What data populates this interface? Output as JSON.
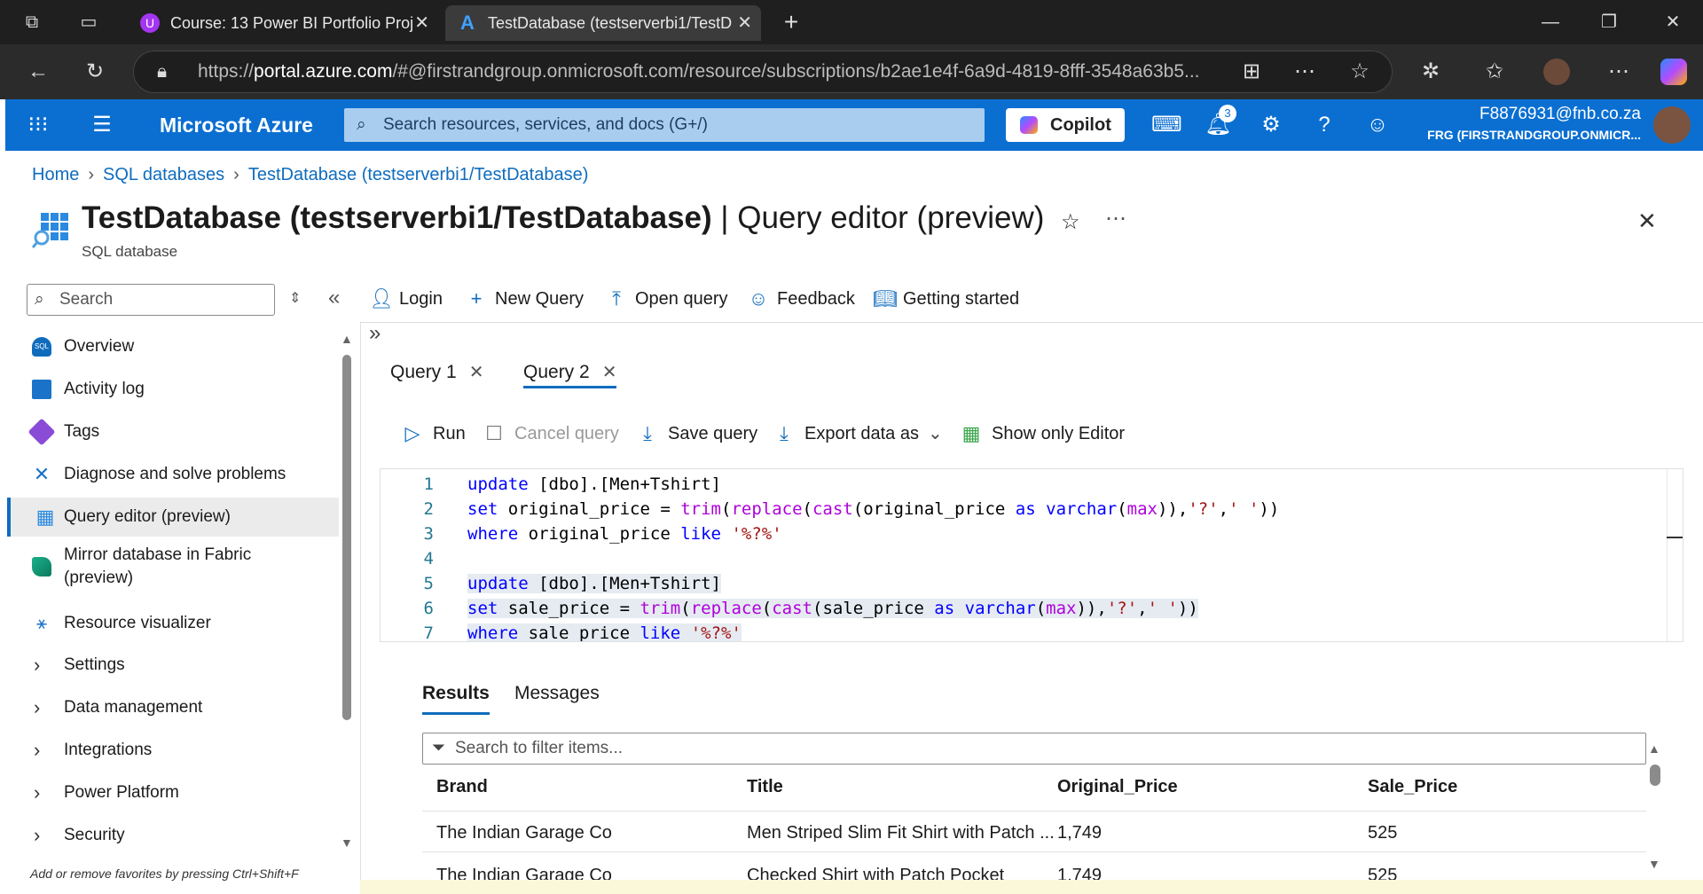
{
  "browser": {
    "tabs": [
      {
        "title": "Course: 13 Power BI Portfolio Proj"
      },
      {
        "title": "TestDatabase (testserverbi1/TestD"
      }
    ],
    "url_prefix": "https://",
    "url_domain": "portal.azure.com",
    "url_rest": "/#@firstrandgroup.onmicrosoft.com/resource/subscriptions/b2ae1e4f-6a9d-4819-8fff-3548a63b5..."
  },
  "azure": {
    "brand": "Microsoft Azure",
    "search_placeholder": "Search resources, services, and docs (G+/)",
    "copilot": "Copilot",
    "notifications_count": "3",
    "account_email": "F8876931@fnb.co.za",
    "account_org": "FRG (FIRSTRANDGROUP.ONMICR..."
  },
  "breadcrumb": [
    "Home",
    "SQL databases",
    "TestDatabase (testserverbi1/TestDatabase)"
  ],
  "page": {
    "title_main": "TestDatabase (testserverbi1/TestDatabase)",
    "title_sep": " | ",
    "title_rest": "Query editor (preview)",
    "subtitle": "SQL database"
  },
  "sidebar": {
    "search_placeholder": "Search",
    "items": [
      {
        "label": "Overview"
      },
      {
        "label": "Activity log"
      },
      {
        "label": "Tags"
      },
      {
        "label": "Diagnose and solve problems"
      },
      {
        "label": "Query editor (preview)"
      },
      {
        "label": "Mirror database in Fabric"
      },
      {
        "label": "(preview)"
      },
      {
        "label": "Resource visualizer"
      },
      {
        "label": "Settings"
      },
      {
        "label": "Data management"
      },
      {
        "label": "Integrations"
      },
      {
        "label": "Power Platform"
      },
      {
        "label": "Security"
      }
    ],
    "favorites_note": "Add or remove favorites by pressing Ctrl+Shift+F"
  },
  "commands": [
    "Login",
    "New Query",
    "Open query",
    "Feedback",
    "Getting started"
  ],
  "query_tabs": [
    "Query 1",
    "Query 2"
  ],
  "toolbar": [
    "Run",
    "Cancel query",
    "Save query",
    "Export data as",
    "Show only Editor"
  ],
  "editor": {
    "line_numbers": [
      "1",
      "2",
      "3",
      "4",
      "5",
      "6",
      "7"
    ]
  },
  "results": {
    "tabs": [
      "Results",
      "Messages"
    ],
    "filter_placeholder": "Search to filter items...",
    "columns": [
      "Brand",
      "Title",
      "Original_Price",
      "Sale_Price"
    ],
    "rows": [
      [
        "The Indian Garage Co",
        "Men Striped Slim Fit Shirt with Patch ...",
        "1,749",
        "525"
      ],
      [
        "The Indian Garage Co",
        "Checked Shirt with Patch Pocket",
        "1,749",
        "525"
      ]
    ]
  }
}
